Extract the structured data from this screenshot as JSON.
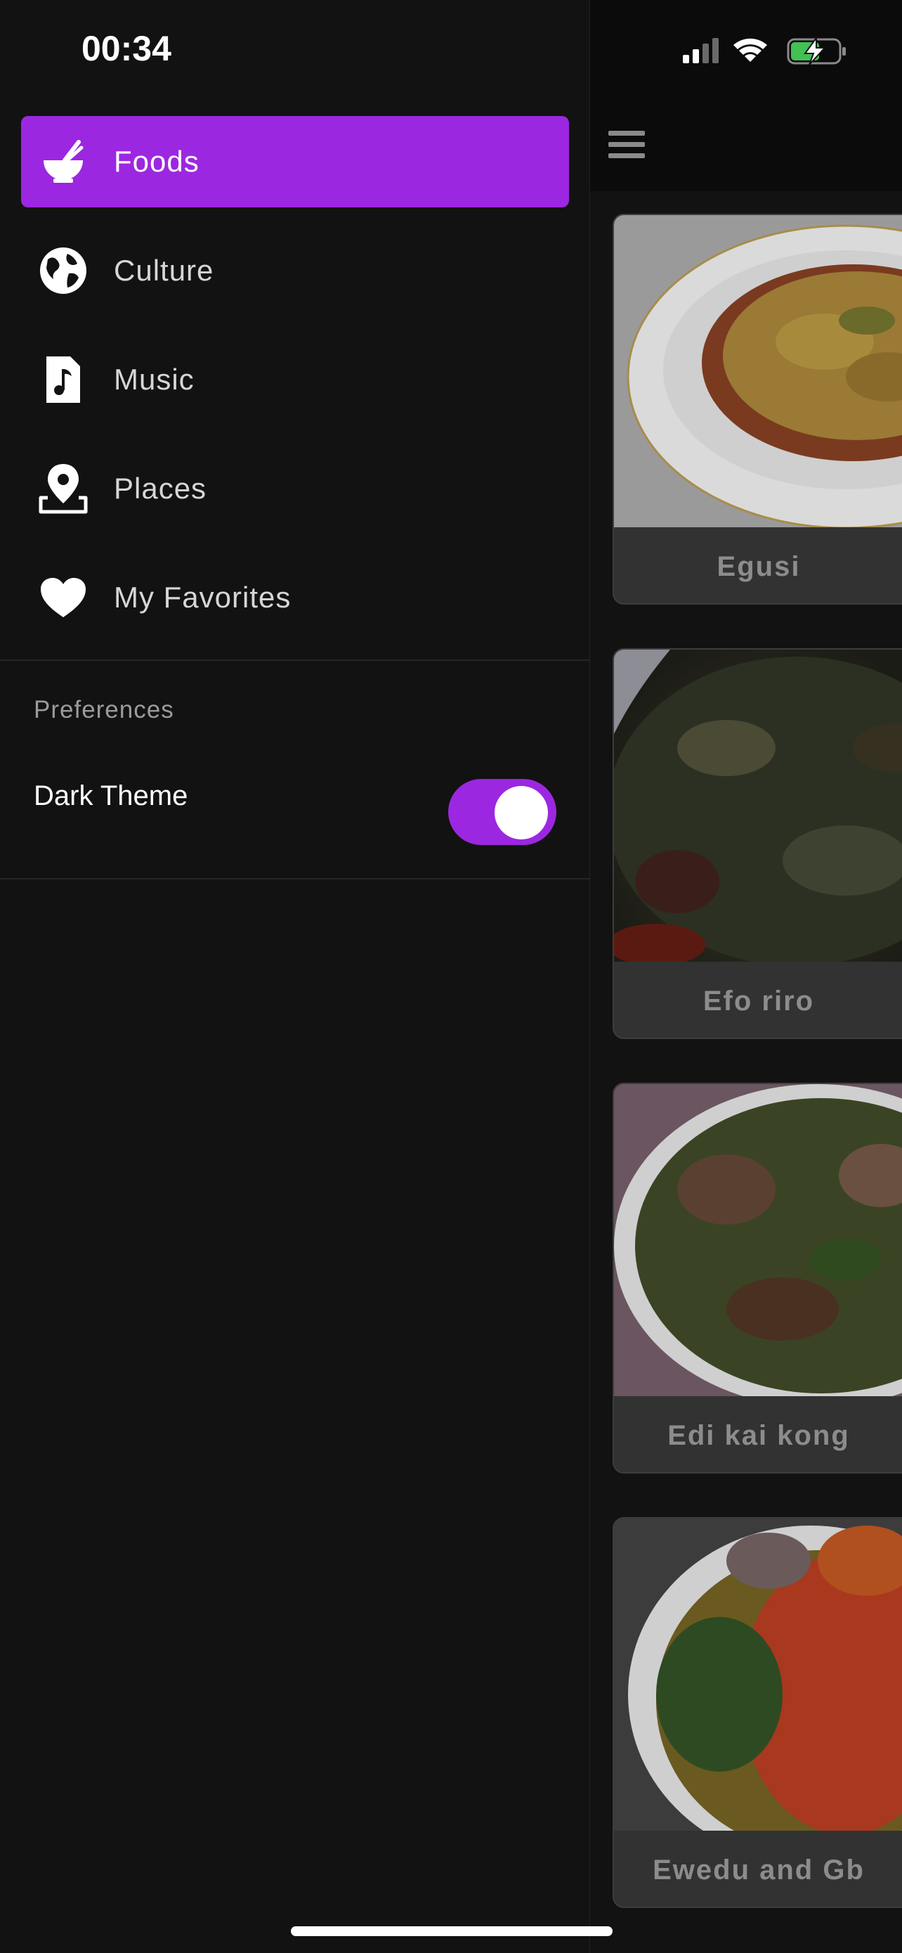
{
  "status_bar": {
    "time": "00:34",
    "icons": [
      "cellular-signal-icon",
      "wifi-icon",
      "battery-charging-icon"
    ]
  },
  "drawer": {
    "nav_items": [
      {
        "label": "Foods",
        "icon": "food-bowl-icon",
        "active": true
      },
      {
        "label": "Culture",
        "icon": "globe-icon",
        "active": false
      },
      {
        "label": "Music",
        "icon": "music-note-icon",
        "active": false
      },
      {
        "label": "Places",
        "icon": "map-pin-icon",
        "active": false
      },
      {
        "label": "My Favorites",
        "icon": "heart-icon",
        "active": false
      }
    ],
    "preferences": {
      "header": "Preferences",
      "dark_theme_label": "Dark Theme",
      "dark_theme_on": true
    }
  },
  "background": {
    "menu_icon": "hamburger-menu-icon",
    "foods": [
      {
        "name": "Egusi"
      },
      {
        "name": "Efo riro"
      },
      {
        "name": "Edi kai kong"
      },
      {
        "name": "Ewedu and Gb"
      }
    ]
  },
  "colors": {
    "accent": "#9c27e0",
    "drawer_bg": "#121212",
    "card_bg": "#323232"
  }
}
